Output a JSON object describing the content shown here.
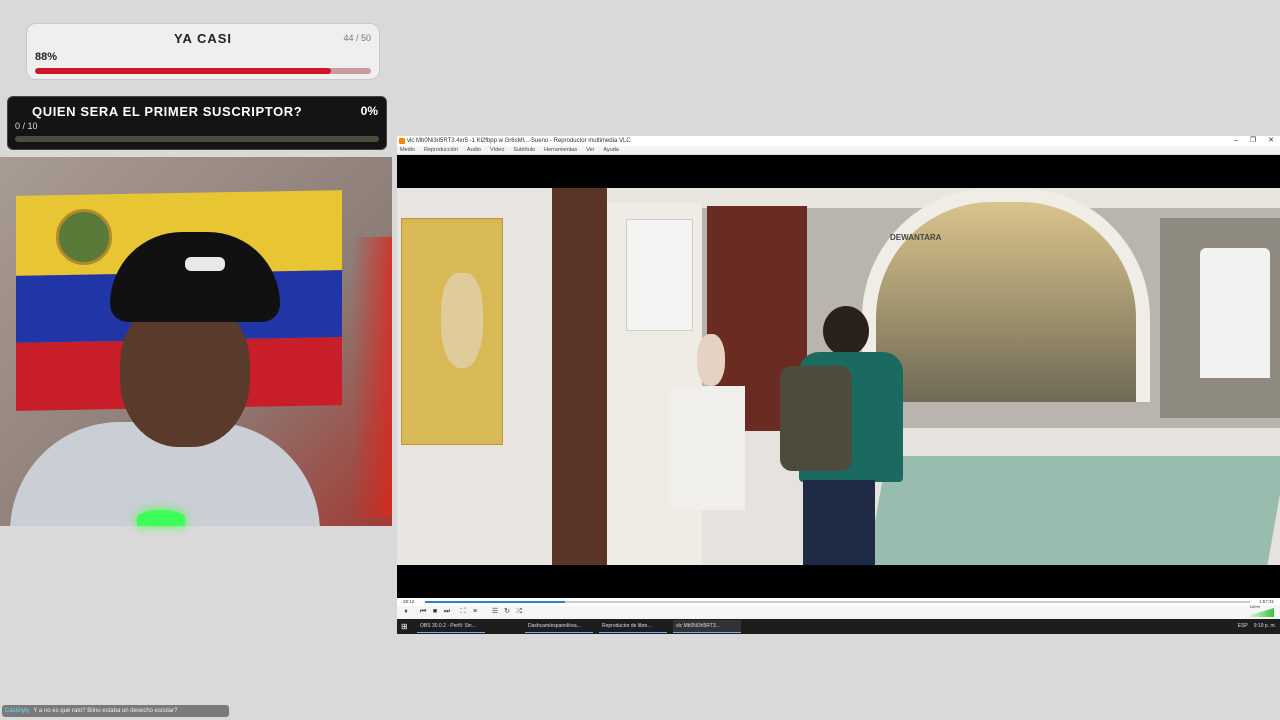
{
  "goal_followers": {
    "title": "YA CASI",
    "count": "44 / 50",
    "percent_label": "88%",
    "progress": 0.88
  },
  "goal_subscriber": {
    "title": "QUIEN SERA EL PRIMER SUSCRIPTOR?",
    "percent_label": "0%",
    "count": "0 / 10",
    "progress": 0
  },
  "video_player": {
    "window_title": "vlc Mb0Ni3rl5RT3.4xr5 -1 Kl2fbpp w Gr6sMl...-Sueno - Reproductor multimedia VLC",
    "window_controls": [
      "–",
      "❐",
      "✕"
    ],
    "menu": [
      "Medio",
      "Reproducción",
      "Audio",
      "Vídeo",
      "Subtítulo",
      "Herramientas",
      "Ver",
      "Ayuda"
    ],
    "scene_sign": "DEWANTARA",
    "time_elapsed": "28:12",
    "time_total": "1:57:31",
    "seek_progress": 0.17,
    "volume_label": "100%",
    "accent_color": "#2b7fd6"
  },
  "taskbar": {
    "start_glyph": "⊞",
    "tasks": [
      "OBS 30.0.2 - Perfil: Sin...",
      "Dashcam/espanol/rea...",
      "Reproductor de libre...",
      "vlc Mb0Ni3rl5RT3..."
    ],
    "tray_lang": "ESP",
    "time": "9:19 p. m."
  },
  "chat": {
    "user": "Castinyly",
    "message": "Y a no es que rato? Bilnu estaba un desecho escolar?"
  }
}
